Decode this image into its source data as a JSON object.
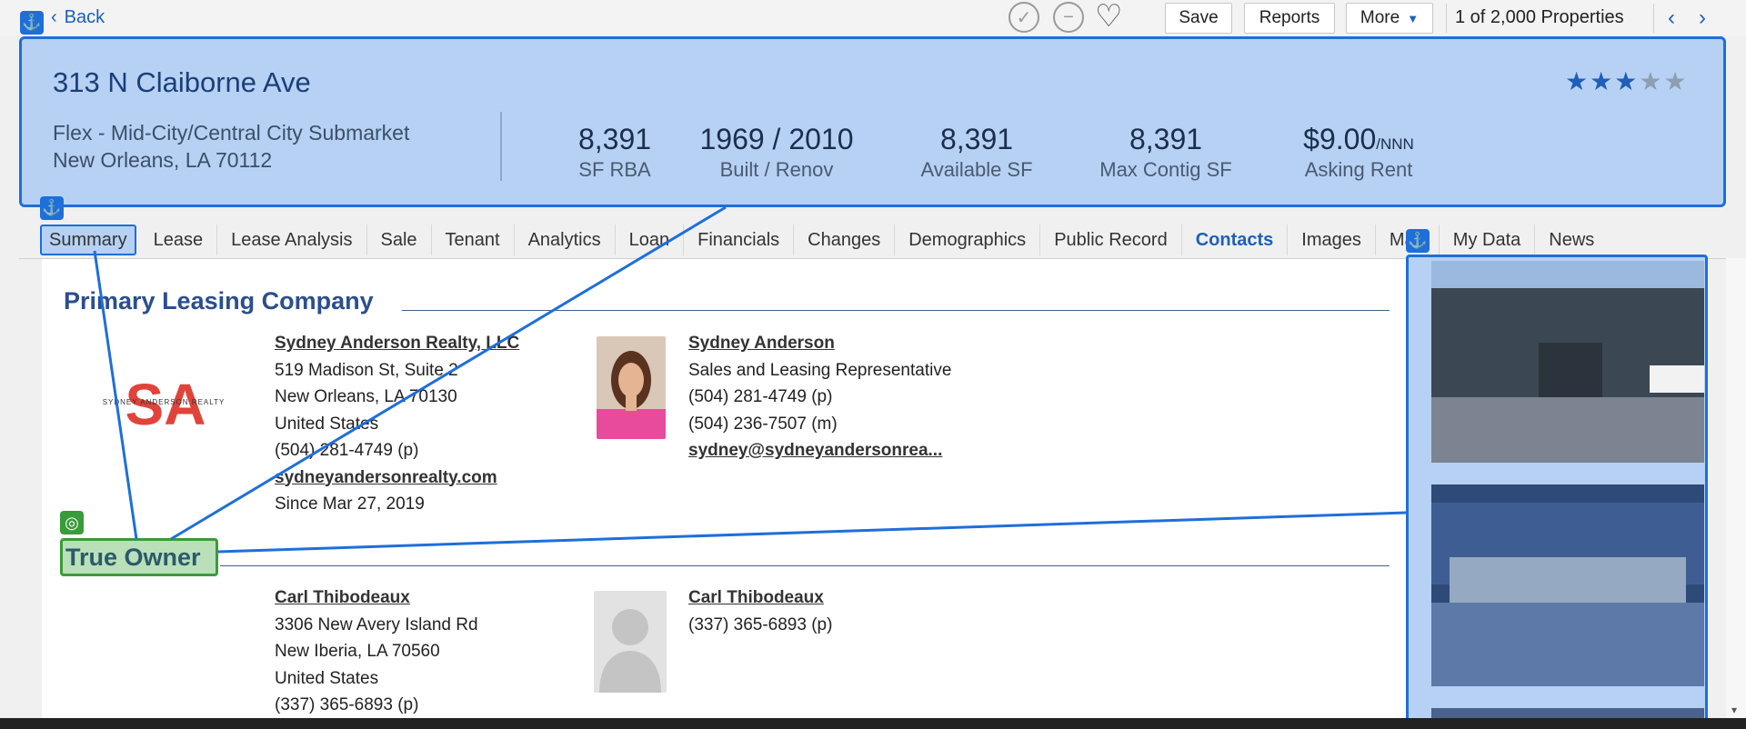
{
  "toolbar": {
    "back_label": "Back",
    "save_label": "Save",
    "reports_label": "Reports",
    "more_label": "More",
    "count_text": "1 of 2,000 Properties"
  },
  "property": {
    "address": "313 N Claiborne Ave",
    "type_line": "Flex - Mid-City/Central City Submarket",
    "city_line": "New Orleans, LA 70112",
    "rating_stars": 3,
    "rating_max": 5,
    "stats": [
      {
        "value": "8,391",
        "label": "SF RBA"
      },
      {
        "value": "1969 / 2010",
        "label": "Built / Renov"
      },
      {
        "value": "8,391",
        "label": "Available SF"
      },
      {
        "value": "8,391",
        "label": "Max Contig SF"
      },
      {
        "value": "$9.00",
        "suffix": "/NNN",
        "label": "Asking Rent"
      }
    ]
  },
  "tabs": [
    "Summary",
    "Lease",
    "Lease Analysis",
    "Sale",
    "Tenant",
    "Analytics",
    "Loan",
    "Financials",
    "Changes",
    "Demographics",
    "Public Record",
    "Contacts",
    "Images",
    "Map",
    "My Data",
    "News"
  ],
  "active_tab": "Contacts",
  "primary_leasing": {
    "heading": "Primary Leasing Company",
    "company": {
      "name": "Sydney Anderson Realty, LLC",
      "street": "519 Madison St, Suite 2",
      "city": "New Orleans, LA 70130",
      "country": "United States",
      "phone": "(504) 281-4749 (p)",
      "website": "sydneyandersonrealty.com",
      "since": "Since Mar 27, 2019",
      "logo_text": "SYDNEY ANDERSON REALTY"
    },
    "contact": {
      "name": "Sydney Anderson",
      "title": "Sales and Leasing Representative",
      "phone": "(504) 281-4749 (p)",
      "mobile": "(504) 236-7507 (m)",
      "email": "sydney@sydneyandersonrea..."
    }
  },
  "true_owner": {
    "heading": "True Owner",
    "company": {
      "name": "Carl Thibodeaux",
      "street": "3306 New Avery Island Rd",
      "city": "New Iberia, LA 70560",
      "country": "United States",
      "phone": "(337) 365-6893 (p)"
    },
    "contact": {
      "name": "Carl Thibodeaux",
      "phone": "(337) 365-6893 (p)"
    }
  },
  "colors": {
    "accent": "#1f5fb8",
    "overlay_blue": "#1e6fd9",
    "overlay_fill": "#b6d1f3",
    "overlay_green": "#3a9b3a"
  }
}
